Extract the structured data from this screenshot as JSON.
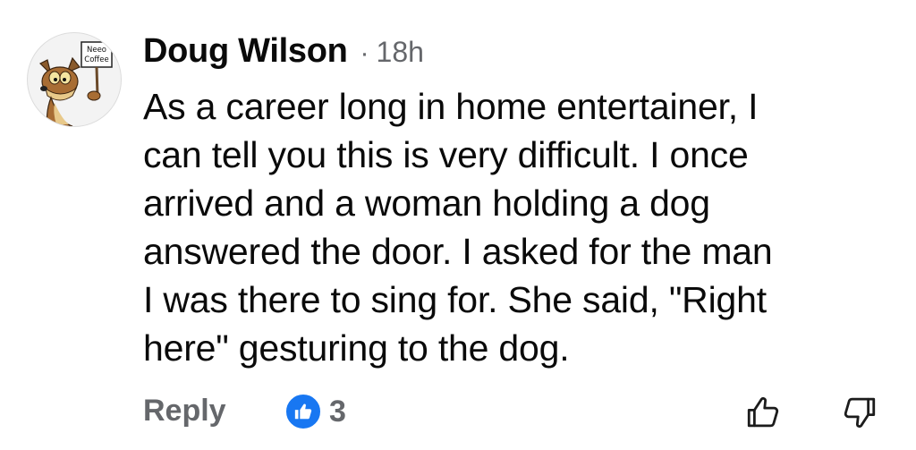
{
  "comment": {
    "author": "Doug Wilson",
    "separator": "·",
    "time": "18h",
    "avatar": {
      "sign_text_line1": "Neeo",
      "sign_text_line2": "Coffee"
    },
    "body_lines": [
      "As a career long in home entertainer, I",
      "can tell you this is very difficult. I once",
      "arrived and a woman holding a dog",
      "answered the door. I asked for the man",
      "I was there to sing for. She said, \"Right",
      "here\" gesturing to the dog."
    ],
    "actions": {
      "reply_label": "Reply",
      "reaction_icon": "like-icon",
      "reaction_count": "3",
      "upvote_icon": "thumbs-up-outline-icon",
      "downvote_icon": "thumbs-down-outline-icon"
    }
  },
  "colors": {
    "text": "#0a0a0a",
    "secondary": "#65676b",
    "like_blue": "#1877f2"
  }
}
